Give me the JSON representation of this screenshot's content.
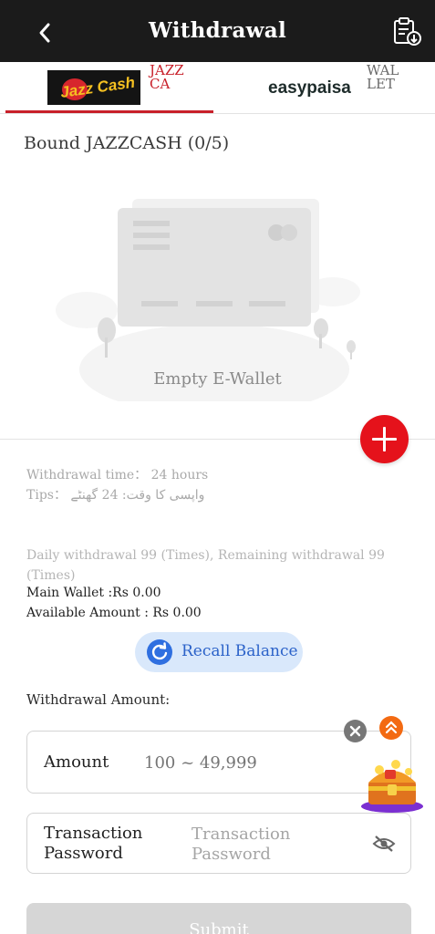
{
  "header": {
    "title": "Withdrawal",
    "back_icon": "chevron-left-icon",
    "record_icon": "clipboard-download-icon"
  },
  "tabs": [
    {
      "logo_text": "Jazz Cash",
      "label": "JAZZCA",
      "active": true,
      "accent": "#c8202a"
    },
    {
      "logo_text": "easypaisa",
      "label": "WALLET",
      "active": false
    }
  ],
  "bound": {
    "title": "Bound JAZZCASH (0/5)"
  },
  "empty": {
    "label": "Empty E-Wallet"
  },
  "info": {
    "withdrawal_time": "Withdrawal time：  24 hours",
    "tips": "Tips：  واپسی کا وقت: 24 گھنٹے",
    "daily": "Daily withdrawal 99 (Times), Remaining withdrawal 99 (Times)",
    "main_wallet": "Main Wallet :Rs 0.00",
    "available": "Available Amount : Rs 0.00"
  },
  "recall": {
    "label": "Recall Balance",
    "icon": "refresh-icon",
    "color": "#2f6fe0"
  },
  "withdrawal": {
    "label": "Withdrawal Amount:",
    "amount_label": "Amount",
    "amount_placeholder": "100 ~ 49,999",
    "password_label": "Transaction Password",
    "password_placeholder": "Transaction Password",
    "eye_icon": "eye-off-icon"
  },
  "submit": {
    "label": "Submit"
  },
  "floating": {
    "close_icon": "close-icon",
    "up_icon": "double-chevron-up-icon",
    "chest_icon": "treasure-chest-icon"
  },
  "colors": {
    "header_bg": "#1b1b1b",
    "add_button": "#e5121b",
    "recall_bg": "#d9e8fb"
  }
}
